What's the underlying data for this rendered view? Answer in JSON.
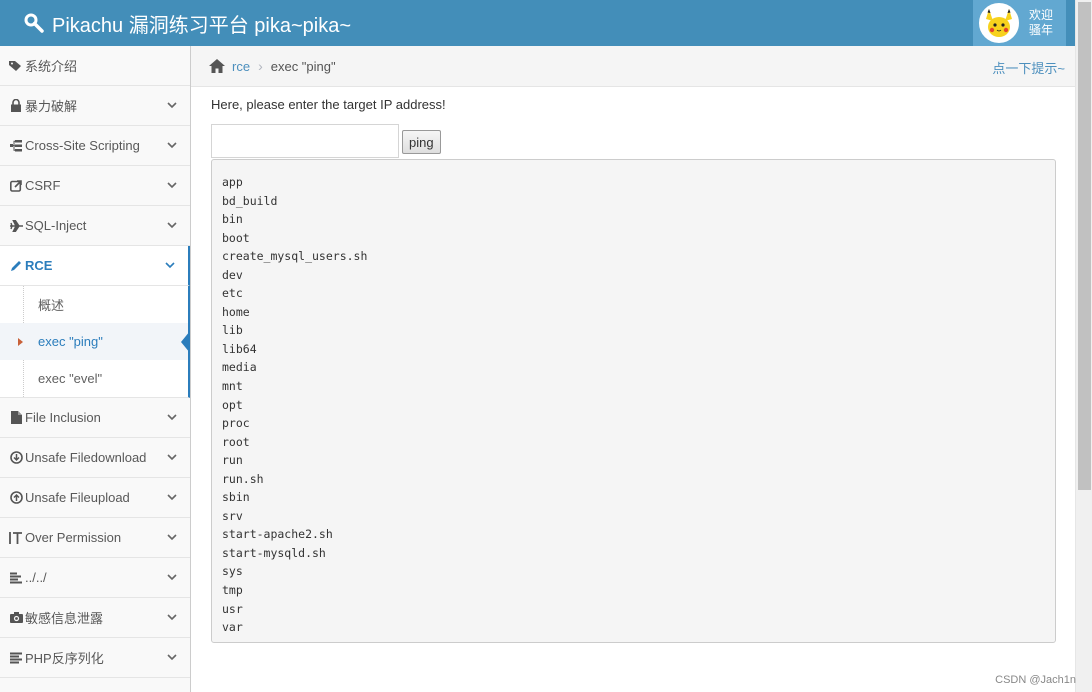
{
  "header": {
    "title": "Pikachu 漏洞练习平台 pika~pika~",
    "user_line1": "欢迎",
    "user_line2": "骚年"
  },
  "sidebar": {
    "items": [
      {
        "label": "系统介绍",
        "icon": "tags-icon"
      },
      {
        "label": "暴力破解",
        "icon": "lock-icon"
      },
      {
        "label": "Cross-Site Scripting",
        "icon": "sitemap-icon"
      },
      {
        "label": "CSRF",
        "icon": "share-icon"
      },
      {
        "label": "SQL-Inject",
        "icon": "plane-icon"
      },
      {
        "label": "RCE",
        "icon": "pencil-icon"
      },
      {
        "label": "File Inclusion",
        "icon": "file-icon"
      },
      {
        "label": "Unsafe Filedownload",
        "icon": "download-icon"
      },
      {
        "label": "Unsafe Fileupload",
        "icon": "upload-icon"
      },
      {
        "label": "Over Permission",
        "icon": "text-height-icon"
      },
      {
        "label": "../../",
        "icon": "align-left-icon"
      },
      {
        "label": "敏感信息泄露",
        "icon": "camera-icon"
      },
      {
        "label": "PHP反序列化",
        "icon": "list-icon"
      }
    ],
    "rce_sub": [
      {
        "label": "概述"
      },
      {
        "label": "exec \"ping\""
      },
      {
        "label": "exec \"evel\""
      }
    ]
  },
  "breadcrumb": {
    "parent": "rce",
    "current": "exec \"ping\"",
    "hint": "点一下提示~"
  },
  "main": {
    "prompt": "Here, please enter the target IP address!",
    "input_value": "",
    "button_label": "ping",
    "output_lines": [
      "app",
      "bd_build",
      "bin",
      "boot",
      "create_mysql_users.sh",
      "dev",
      "etc",
      "home",
      "lib",
      "lib64",
      "media",
      "mnt",
      "opt",
      "proc",
      "root",
      "run",
      "run.sh",
      "sbin",
      "srv",
      "start-apache2.sh",
      "start-mysqld.sh",
      "sys",
      "tmp",
      "usr",
      "var"
    ]
  },
  "watermark": "CSDN @Jach1n",
  "colors": {
    "navbar": "#438eb9",
    "user_box": "#62a8d1",
    "accent": "#2b7dbc",
    "link": "#4c8fbd"
  }
}
